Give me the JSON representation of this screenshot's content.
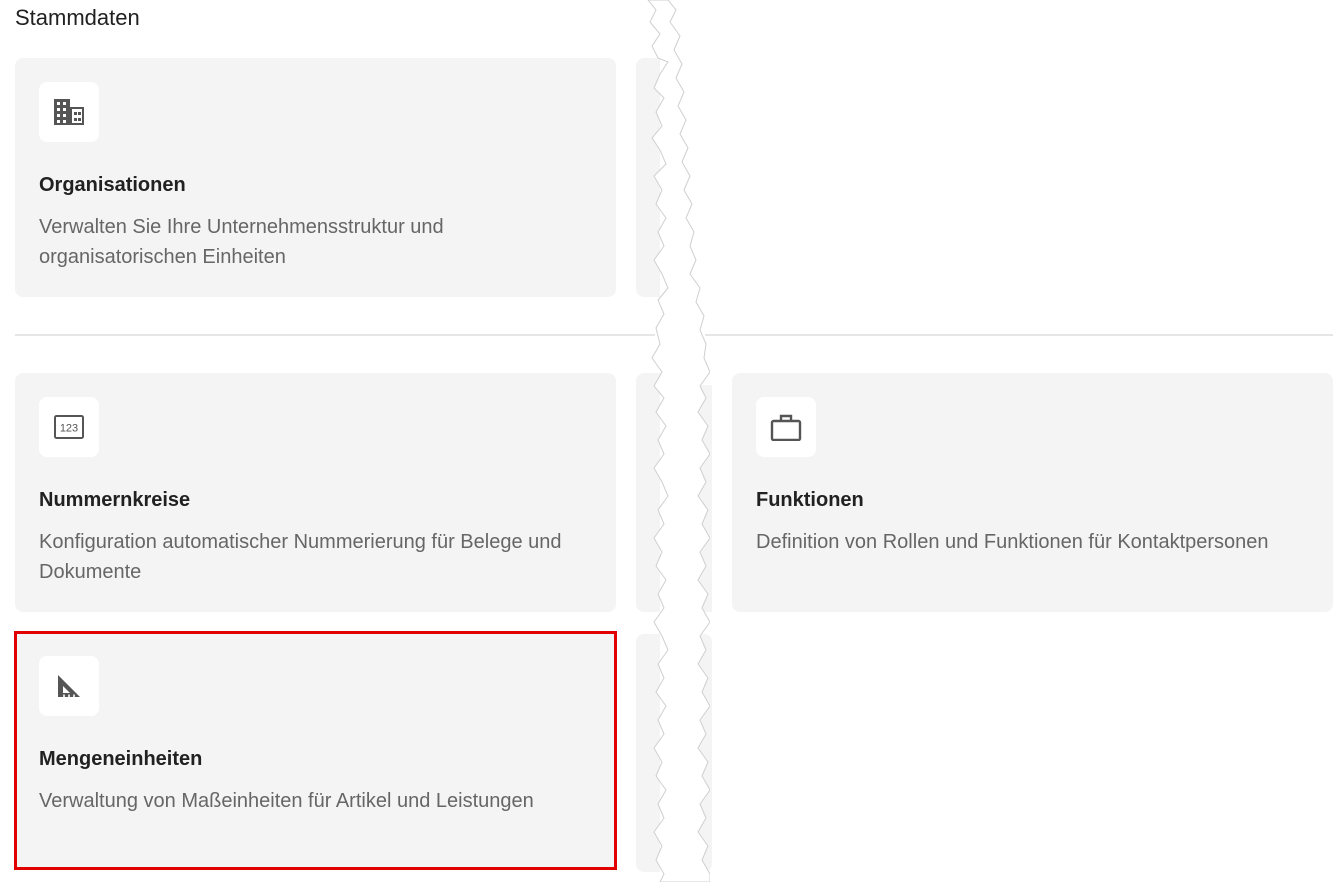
{
  "section": {
    "title": "Stammdaten"
  },
  "cards": [
    {
      "icon": "building-icon",
      "title": "Organisationen",
      "description": "Verwalten Sie Ihre Unternehmensstruktur und organisatorischen Einheiten"
    },
    {
      "icon": "numbers-123-icon",
      "title": "Nummernkreise",
      "description": "Konfiguration automatischer Nummerierung für Belege und Dokumente"
    },
    {
      "icon": "briefcase-icon",
      "title": "Funktionen",
      "description": "Definition von Rollen und Funktionen für Kontaktpersonen"
    },
    {
      "icon": "set-square-ruler-icon",
      "title": "Mengeneinheiten",
      "description": "Verwaltung von Maßeinheiten für Artikel und Leistungen"
    }
  ],
  "colors": {
    "card_background": "#f4f4f4",
    "highlight_border": "#e00000",
    "icon_color": "#555555",
    "description_text": "#666666"
  }
}
